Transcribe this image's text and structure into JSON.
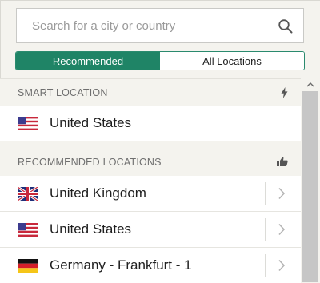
{
  "search": {
    "placeholder": "Search for a city or country",
    "value": ""
  },
  "tabs": [
    {
      "label": "Recommended",
      "active": true
    },
    {
      "label": "All Locations",
      "active": false
    }
  ],
  "sections": {
    "smart": {
      "title": "SMART LOCATION",
      "icon": "lightning-icon",
      "item": {
        "label": "United States",
        "flag": "us-flag-icon"
      }
    },
    "recommended": {
      "title": "RECOMMENDED LOCATIONS",
      "icon": "thumbs-up-icon",
      "items": [
        {
          "label": "United Kingdom",
          "flag": "uk-flag-icon"
        },
        {
          "label": "United States",
          "flag": "us-flag-icon"
        },
        {
          "label": "Germany - Frankfurt - 1",
          "flag": "germany-flag-icon"
        }
      ]
    }
  },
  "colors": {
    "accent": "#1f8466",
    "background": "#f4f3ee",
    "row": "#ffffff"
  }
}
